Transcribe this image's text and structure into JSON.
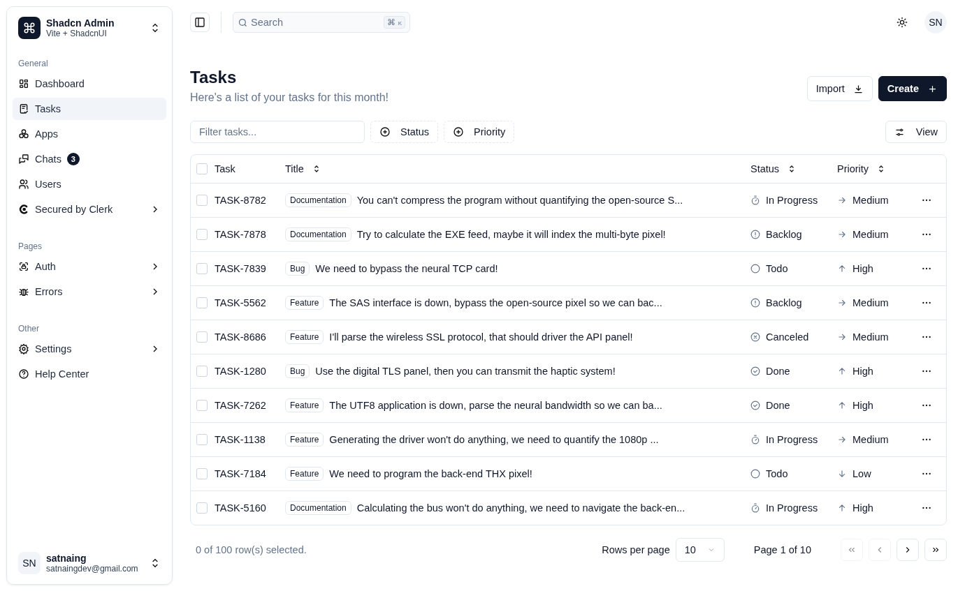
{
  "sidebar": {
    "brand": {
      "name": "Shadcn Admin",
      "subtitle": "Vite + ShadcnUI"
    },
    "groups": [
      {
        "title": "General",
        "items": [
          {
            "label": "Dashboard",
            "selected": false,
            "has_submenu": false
          },
          {
            "label": "Tasks",
            "selected": true,
            "has_submenu": false
          },
          {
            "label": "Apps",
            "selected": false,
            "has_submenu": false
          },
          {
            "label": "Chats",
            "selected": false,
            "has_submenu": false,
            "badge": "3"
          },
          {
            "label": "Users",
            "selected": false,
            "has_submenu": false
          },
          {
            "label": "Secured by Clerk",
            "selected": false,
            "has_submenu": true
          }
        ]
      },
      {
        "title": "Pages",
        "items": [
          {
            "label": "Auth",
            "selected": false,
            "has_submenu": true
          },
          {
            "label": "Errors",
            "selected": false,
            "has_submenu": true
          }
        ]
      },
      {
        "title": "Other",
        "items": [
          {
            "label": "Settings",
            "selected": false,
            "has_submenu": true
          },
          {
            "label": "Help Center",
            "selected": false,
            "has_submenu": false
          }
        ]
      }
    ],
    "user": {
      "initials": "SN",
      "name": "satnaing",
      "email": "satnaingdev@gmail.com"
    }
  },
  "header": {
    "search": {
      "placeholder": "Search",
      "shortcut": "⌘",
      "shortcut_key": "K"
    },
    "avatar": "SN"
  },
  "page": {
    "title": "Tasks",
    "subtitle": "Here's a list of your tasks for this month!",
    "import_button": "Import",
    "create_button": "Create"
  },
  "toolbar": {
    "filter": {
      "placeholder": "Filter tasks..."
    },
    "facets": [
      "Status",
      "Priority"
    ],
    "view_button": "View"
  },
  "table": {
    "select_all": {
      "checked": false
    },
    "columns": [
      "Task",
      "Title",
      "Status",
      "Priority"
    ],
    "rows": [
      {
        "checked": false,
        "id": "TASK-8782",
        "label": "Documentation",
        "title": "You can't compress the program without quantifying the open-source S...",
        "status": {
          "kind": "in_progress",
          "text": "In Progress"
        },
        "priority": {
          "kind": "medium",
          "text": "Medium"
        }
      },
      {
        "checked": false,
        "id": "TASK-7878",
        "label": "Documentation",
        "title": "Try to calculate the EXE feed, maybe it will index the multi-byte pixel!",
        "status": {
          "kind": "backlog",
          "text": "Backlog"
        },
        "priority": {
          "kind": "medium",
          "text": "Medium"
        }
      },
      {
        "checked": false,
        "id": "TASK-7839",
        "label": "Bug",
        "title": "We need to bypass the neural TCP card!",
        "status": {
          "kind": "todo",
          "text": "Todo"
        },
        "priority": {
          "kind": "high",
          "text": "High"
        }
      },
      {
        "checked": false,
        "id": "TASK-5562",
        "label": "Feature",
        "title": "The SAS interface is down, bypass the open-source pixel so we can bac...",
        "status": {
          "kind": "backlog",
          "text": "Backlog"
        },
        "priority": {
          "kind": "medium",
          "text": "Medium"
        }
      },
      {
        "checked": false,
        "id": "TASK-8686",
        "label": "Feature",
        "title": "I'll parse the wireless SSL protocol, that should driver the API panel!",
        "status": {
          "kind": "canceled",
          "text": "Canceled"
        },
        "priority": {
          "kind": "medium",
          "text": "Medium"
        }
      },
      {
        "checked": false,
        "id": "TASK-1280",
        "label": "Bug",
        "title": "Use the digital TLS panel, then you can transmit the haptic system!",
        "status": {
          "kind": "done",
          "text": "Done"
        },
        "priority": {
          "kind": "high",
          "text": "High"
        }
      },
      {
        "checked": false,
        "id": "TASK-7262",
        "label": "Feature",
        "title": "The UTF8 application is down, parse the neural bandwidth so we can ba...",
        "status": {
          "kind": "done",
          "text": "Done"
        },
        "priority": {
          "kind": "high",
          "text": "High"
        }
      },
      {
        "checked": false,
        "id": "TASK-1138",
        "label": "Feature",
        "title": "Generating the driver won't do anything, we need to quantify the 1080p ...",
        "status": {
          "kind": "in_progress",
          "text": "In Progress"
        },
        "priority": {
          "kind": "medium",
          "text": "Medium"
        }
      },
      {
        "checked": false,
        "id": "TASK-7184",
        "label": "Feature",
        "title": "We need to program the back-end THX pixel!",
        "status": {
          "kind": "todo",
          "text": "Todo"
        },
        "priority": {
          "kind": "low",
          "text": "Low"
        }
      },
      {
        "checked": false,
        "id": "TASK-5160",
        "label": "Documentation",
        "title": "Calculating the bus won't do anything, we need to navigate the back-en...",
        "status": {
          "kind": "in_progress",
          "text": "In Progress"
        },
        "priority": {
          "kind": "high",
          "text": "High"
        }
      }
    ]
  },
  "footer": {
    "selection": "0 of 100 row(s) selected.",
    "rows_per_page_label": "Rows per page",
    "rows_per_page": "10",
    "page_info": "Page 1 of 10",
    "pager": [
      {
        "kind": "first",
        "disabled": true
      },
      {
        "kind": "prev",
        "disabled": true
      },
      {
        "kind": "next",
        "disabled": false
      },
      {
        "kind": "last",
        "disabled": false
      }
    ]
  }
}
